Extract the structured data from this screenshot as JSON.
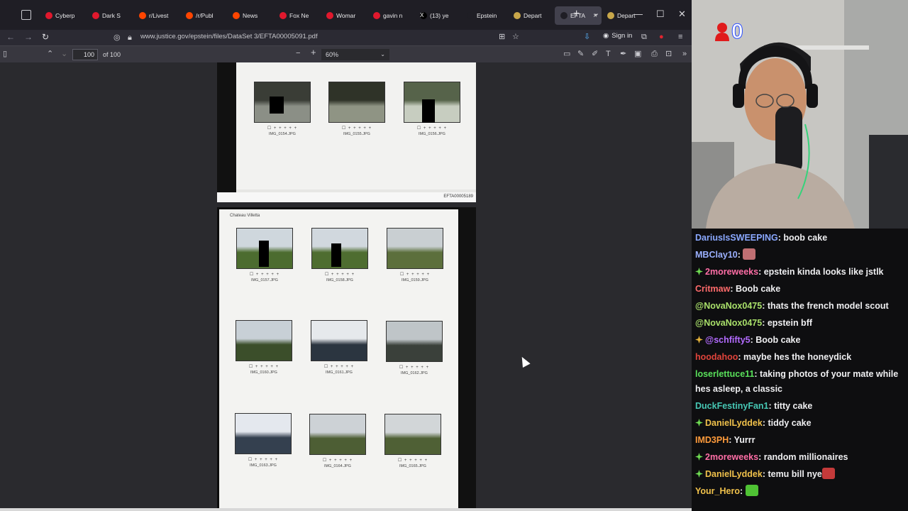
{
  "tabs": [
    {
      "label": "Cyberp",
      "color": "#e0182d"
    },
    {
      "label": "Dark S",
      "color": "#e0182d"
    },
    {
      "label": "r/Livest",
      "color": "#ff4500"
    },
    {
      "label": "/r/Publ",
      "color": "#ff4500"
    },
    {
      "label": "News",
      "color": "#ff4500"
    },
    {
      "label": "Fox Ne",
      "color": "#e0182d"
    },
    {
      "label": "Womar",
      "color": "#e0182d"
    },
    {
      "label": "gavin n",
      "color": "#e0182d"
    },
    {
      "label": "(13) ye",
      "color": "#000000",
      "glyph": "X"
    },
    {
      "label": "Epstein",
      "color": "#1f1e25"
    },
    {
      "label": "Depart",
      "color": "#c8a74a"
    },
    {
      "label": "EFTA",
      "color": "#1f1e25",
      "active": true,
      "close": "×"
    },
    {
      "label": "Depart",
      "color": "#c8a74a"
    }
  ],
  "window": {
    "new_tab": "+",
    "tab_list": "⌄",
    "minimize": "—",
    "maximize": "☐",
    "close": "✕"
  },
  "navbar": {
    "url": "www.justice.gov/epstein/files/DataSet 3/EFTA00005091.pdf",
    "sign_in": "Sign in",
    "icons": [
      "back-icon",
      "forward-icon",
      "reload-icon",
      "shield-icon",
      "lock-icon",
      "reader-icon",
      "bookmark-star-icon",
      "download-icon",
      "account-icon",
      "extensions-icon",
      "ublock-icon",
      "menu-icon"
    ]
  },
  "pdf_toolbar": {
    "page_number": "100",
    "of_pages": "of 100",
    "zoom_out": "−",
    "zoom_in": "+",
    "zoom": "60%"
  },
  "page1": {
    "stamp": "EFTA00005189",
    "thumbs": [
      {
        "caption": "IMG_0154.JPG",
        "colors": [
          "#3a3d36",
          "#8b8f86"
        ]
      },
      {
        "caption": "IMG_0155.JPG",
        "colors": [
          "#2f3328",
          "#8f9484"
        ]
      },
      {
        "caption": "IMG_0156.JPG",
        "colors": [
          "#56634a",
          "#c7cdc0"
        ]
      }
    ]
  },
  "page2": {
    "title": "Chateau Villetta",
    "thumbs": [
      {
        "caption": "IMG_0157.JPG",
        "colors": [
          "#cfd7dd",
          "#4c6c2f"
        ]
      },
      {
        "caption": "IMG_0158.JPG",
        "colors": [
          "#d1d8de",
          "#4e6d30"
        ]
      },
      {
        "caption": "IMG_0159.JPG",
        "colors": [
          "#c9cfd2",
          "#5c6f3c"
        ]
      },
      {
        "caption": "IMG_0160.JPG",
        "colors": [
          "#c8d0d6",
          "#3b4e2a"
        ]
      },
      {
        "caption": "IMG_0161.JPG",
        "colors": [
          "#e6e9ec",
          "#2b3540"
        ]
      },
      {
        "caption": "IMG_0162.JPG",
        "colors": [
          "#bfc5c8",
          "#3a403a"
        ]
      },
      {
        "caption": "IMG_0163.JPG",
        "colors": [
          "#e4e8ee",
          "#34404f"
        ]
      },
      {
        "caption": "IMG_0164.JPG",
        "colors": [
          "#cdd2d6",
          "#4d5e34"
        ]
      },
      {
        "caption": "IMG_0165.JPG",
        "colors": [
          "#d2d6d8",
          "#4f6035"
        ]
      }
    ]
  },
  "thumb_checks": "☐ + + + + +",
  "overlay": {
    "score": "0"
  },
  "chat": [
    {
      "user": "DariusIsSWEEPING",
      "color": "#8aa8ff",
      "text": ": boob cake"
    },
    {
      "user": "MBClay10",
      "color": "#9bb0ff",
      "text": ": ",
      "emote": "#c06f73"
    },
    {
      "user": "2moreweeks",
      "color": "#ff6ea6",
      "text": ": epstein kinda looks like jstlk",
      "badge": "#6fdc53"
    },
    {
      "user": "Critmaw",
      "color": "#ff6b6b",
      "text": ": Boob cake"
    },
    {
      "user": "@NovaNox0475",
      "color": "#a9e06a",
      "text": ": thats the french model scout"
    },
    {
      "user": "@NovaNox0475",
      "color": "#a9e06a",
      "text": ": epstein bff"
    },
    {
      "user": "@schfifty5",
      "color": "#b36bff",
      "text": ": Boob cake",
      "badge": "#e7b43b"
    },
    {
      "user": "hoodahoo",
      "color": "#e0443b",
      "text": ": maybe hes the honeydick"
    },
    {
      "user": "loserlettuce11",
      "color": "#59e05a",
      "text": ": taking photos of your mate while hes asleep, a classic",
      "wrap": true
    },
    {
      "user": "DuckFestinyFan1",
      "color": "#46c7b4",
      "text": ": titty cake"
    },
    {
      "user": "DanielLyddek",
      "color": "#f0c14b",
      "text": ": tiddy cake",
      "badge": "#6fdc53"
    },
    {
      "user": "IMD3PH",
      "color": "#ff9b3b",
      "text": ": Yurrr"
    },
    {
      "user": "2moreweeks",
      "color": "#ff6ea6",
      "text": ": random millionaires",
      "badge": "#6fdc53"
    },
    {
      "user": "DanielLyddek",
      "color": "#f0c14b",
      "text": ": temu bill nye",
      "badge": "#6fdc53",
      "emote": "#c43a3a"
    },
    {
      "user": "Your_Hero",
      "color": "#f0c14b",
      "text": ": ",
      "emote": "#4fc234"
    }
  ]
}
